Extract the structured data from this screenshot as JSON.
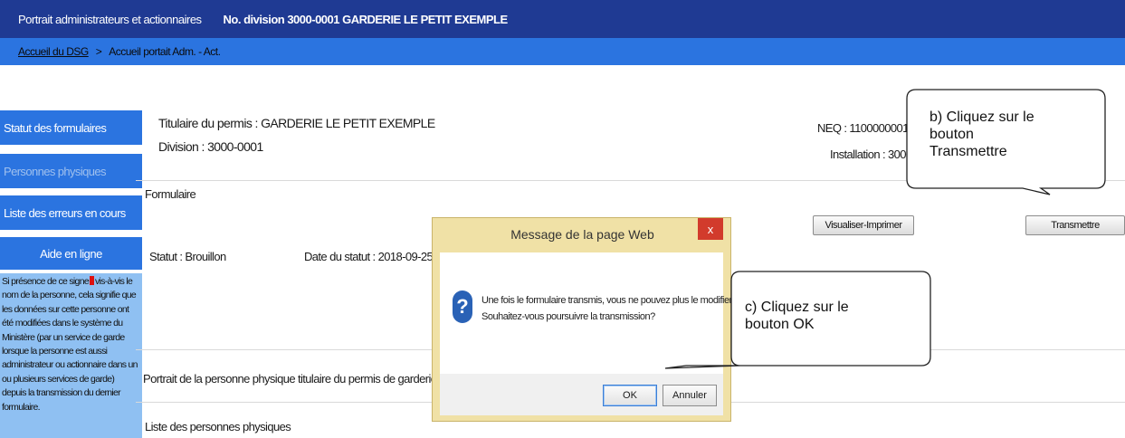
{
  "header": {
    "app_title": "Portrait administrateurs et actionnaires",
    "division": "No. division 3000-0001  GARDERIE LE PETIT EXEMPLE"
  },
  "breadcrumb": {
    "home": "Accueil du DSG",
    "separator": ">",
    "current": "Accueil portait Adm. - Act."
  },
  "sidebar": {
    "items": [
      {
        "label": "Statut des formulaires"
      },
      {
        "label": "Personnes physiques"
      },
      {
        "label": "Liste des erreurs en cours"
      }
    ],
    "help_title": "Aide en ligne",
    "help_text_before": "Si présence de ce signe",
    "help_text_after": "vis-à-vis le nom de la personne, cela signifie que les données sur cette personne ont été modifiées dans le système du Ministère (par un service de garde lorsque la personne est aussi administrateur ou actionnaire dans un ou plusieurs services de garde) depuis la transmission du dernier formulaire."
  },
  "main": {
    "titulaire": "Titulaire du permis :  GARDERIE LE PETIT EXEMPLE",
    "division": "Division : 3000-0001",
    "neq": "NEQ : 1100000001",
    "installation": "Installation : 3000",
    "section_formulaire": "Formulaire",
    "statut": "Statut : Brouillon",
    "date_statut": "Date du statut : 2018-09-25",
    "section_portrait": "Portrait de la personne physique titulaire du permis de garderie",
    "section_liste": "Liste des personnes physiques",
    "btn_visualiser": "Visualiser-Imprimer",
    "btn_transmettre": "Transmettre"
  },
  "dialog": {
    "title": "Message de la page Web",
    "close": "x",
    "line1": "Une fois le formulaire transmis, vous ne pouvez plus le modifier.",
    "line2": "Souhaitez-vous poursuivre la transmission?",
    "ok": "OK",
    "cancel": "Annuler"
  },
  "callouts": {
    "b_line1": "b) Cliquez sur le",
    "b_line2": "bouton",
    "b_line3": "Transmettre",
    "c_line1": "c) Cliquez sur le",
    "c_line2": "bouton OK"
  },
  "colors": {
    "topbar": "#1f3a93",
    "accent": "#2b74e0",
    "help_bg": "#8fc0f2",
    "dialog_frame": "#f0e1a6",
    "close_red": "#d23b2c"
  }
}
